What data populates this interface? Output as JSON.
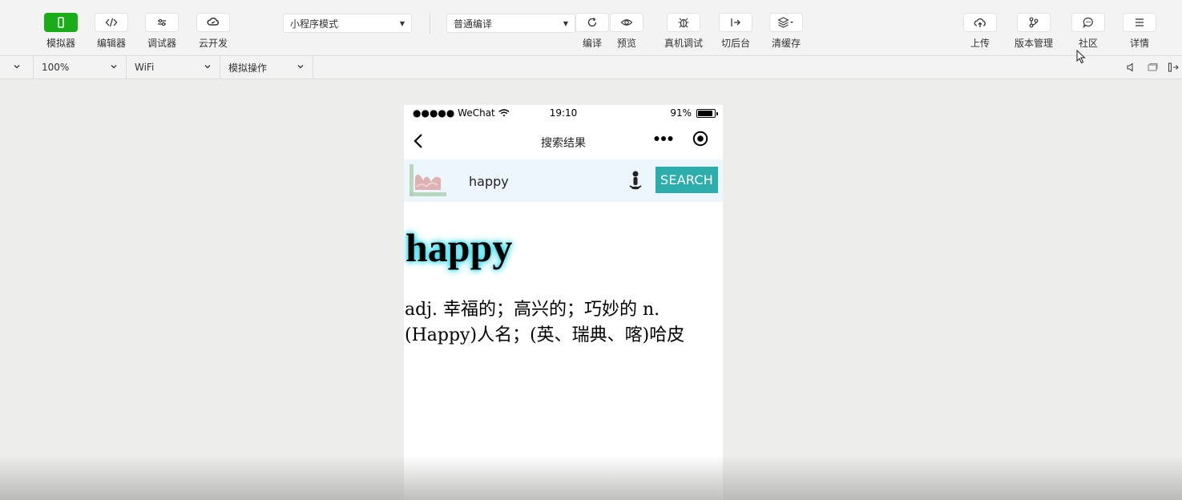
{
  "toolbar": {
    "left": [
      {
        "label": "模拟器",
        "icon": "phone-icon"
      },
      {
        "label": "编辑器",
        "icon": "code-icon"
      },
      {
        "label": "调试器",
        "icon": "sliders-icon"
      },
      {
        "label": "云开发",
        "icon": "cloud-link-icon"
      }
    ],
    "mode_select": "小程序模式",
    "compile_select": "普通编译",
    "middle": [
      {
        "label": "编译",
        "icon": "refresh-icon"
      },
      {
        "label": "预览",
        "icon": "eye-icon"
      },
      {
        "label": "真机调试",
        "icon": "bug-icon"
      },
      {
        "label": "切后台",
        "icon": "switch-background-icon"
      },
      {
        "label": "清缓存",
        "icon": "layers-icon"
      }
    ],
    "right": [
      {
        "label": "上传",
        "icon": "cloud-upload-icon"
      },
      {
        "label": "版本管理",
        "icon": "branch-icon"
      },
      {
        "label": "社区",
        "icon": "chat-icon"
      },
      {
        "label": "详情",
        "icon": "menu-icon"
      }
    ]
  },
  "subbar": {
    "zoom": "100%",
    "network": "WiFi",
    "simulate": "模拟操作"
  },
  "phone": {
    "status": {
      "carrier": "●●●●● WeChat",
      "time": "19:10",
      "battery": "91%",
      "battery_level": 0.91
    },
    "nav_title": "搜索结果",
    "search": {
      "query": "happy",
      "button": "SEARCH"
    },
    "word": "happy",
    "definition_line1": "adj. 幸福的；高兴的；巧妙的 n.",
    "definition_line2": "(Happy)人名；(英、瑞典、喀)哈皮"
  },
  "colors": {
    "accent_green": "#1aad19",
    "search_button": "#2eadad",
    "glow": "#19d6e8"
  }
}
